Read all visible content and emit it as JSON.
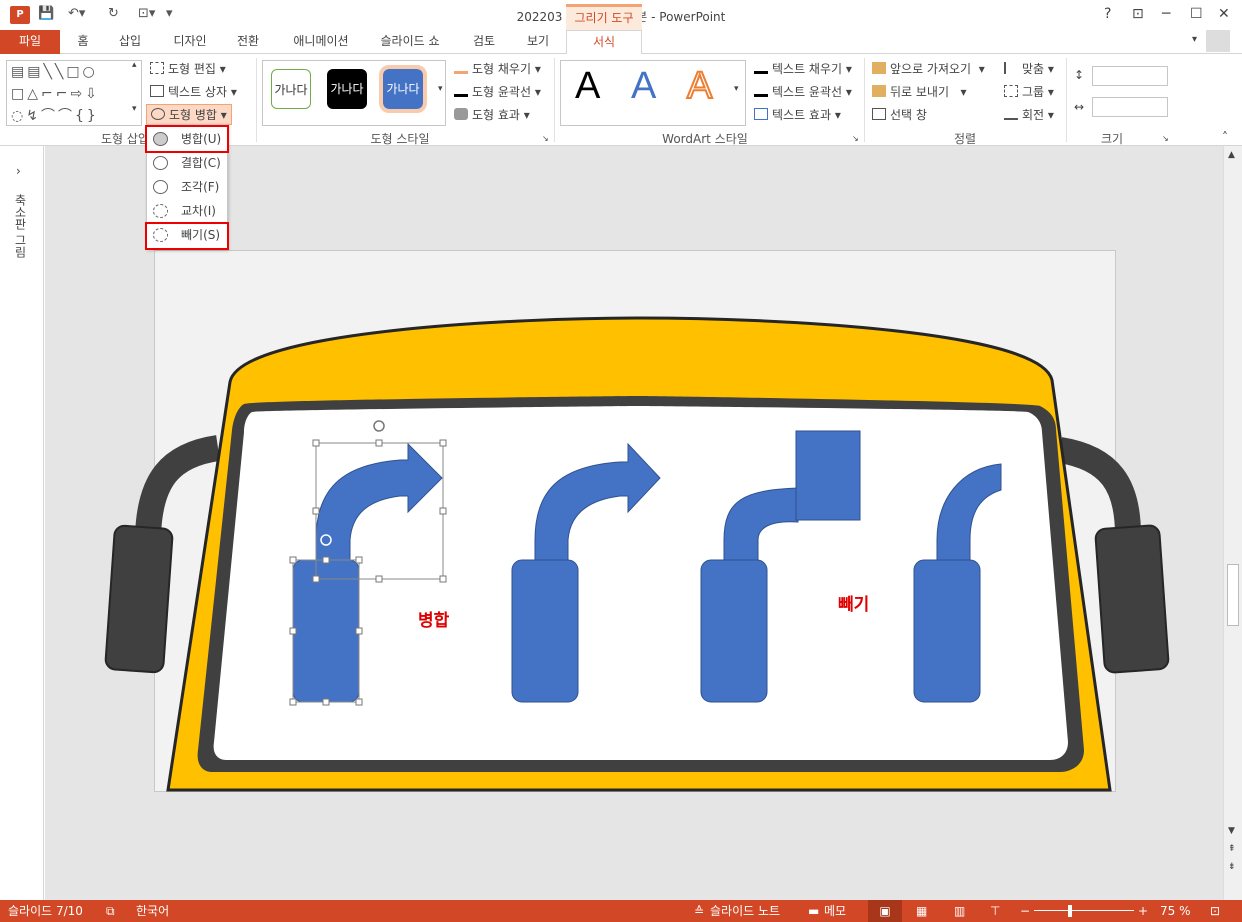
{
  "window": {
    "title": "202203 포스팅용 완성본 - PowerPoint",
    "contextual_tab": "그리기 도구",
    "help": "?",
    "minimize": "─",
    "maximize": "☐",
    "close": "✕"
  },
  "tabs": [
    "파일",
    "홈",
    "삽입",
    "디자인",
    "전환",
    "애니메이션",
    "슬라이드 쇼",
    "검토",
    "보기",
    "서식"
  ],
  "ribbon": {
    "insert_shapes": {
      "label": "도형 삽입",
      "edit_shape": "도형 편집",
      "text_box": "텍스트 상자",
      "merge_shapes": "도형 병합"
    },
    "shape_styles": {
      "label": "도형 스타일",
      "preview_text": "가나다",
      "fill": "도형 채우기",
      "outline": "도형 윤곽선",
      "effects": "도형 효과"
    },
    "wordart": {
      "label": "WordArt 스타일",
      "letter": "A",
      "text_fill": "텍스트 채우기",
      "text_outline": "텍스트 윤곽선",
      "text_effects": "텍스트 효과"
    },
    "arrange": {
      "label": "정렬",
      "bring_forward": "앞으로 가져오기",
      "send_backward": "뒤로 보내기",
      "selection_pane": "선택 창",
      "align": "맞춤",
      "group": "그룹",
      "rotate": "회전"
    },
    "size": {
      "label": "크기"
    }
  },
  "merge_menu": {
    "items": [
      "병합(U)",
      "결합(C)",
      "조각(F)",
      "교차(I)",
      "빼기(S)"
    ]
  },
  "left_pane": {
    "label": "축소판 그림"
  },
  "slide": {
    "label_merge": "병합",
    "label_subtract": "빼기"
  },
  "status": {
    "slide_info": "슬라이드 7/10",
    "language": "한국어",
    "notes": "슬라이드 노트",
    "comments": "메모",
    "zoom": "75 %"
  },
  "colors": {
    "accent": "#d24726",
    "shape_blue": "#4472c4",
    "bus_yellow": "#ffc000",
    "dark": "#404040",
    "label_red": "#e00000"
  }
}
